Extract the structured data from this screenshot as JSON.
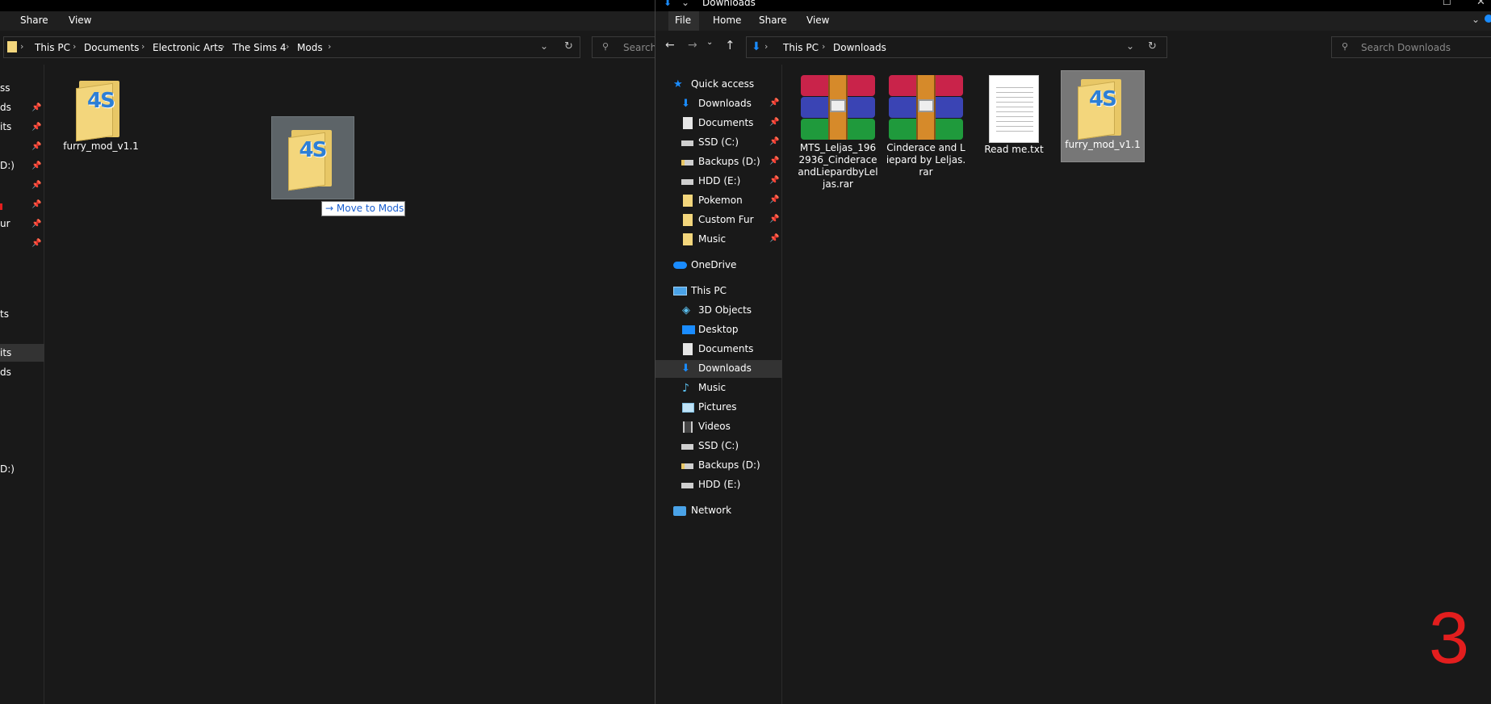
{
  "left_window": {
    "ribbon_tabs": [
      "Share",
      "View"
    ],
    "breadcrumb": [
      "This PC",
      "Documents",
      "Electronic Arts",
      "The Sims 4",
      "Mods"
    ],
    "search_placeholder": "Search",
    "sidebar_fragments": [
      {
        "text": "ss",
        "pinned": false
      },
      {
        "text": "ds",
        "pinned": true
      },
      {
        "text": "its",
        "pinned": true
      },
      {
        "text": "",
        "pinned": true
      },
      {
        "text": "D:)",
        "pinned": true
      },
      {
        "text": "",
        "pinned": true
      },
      {
        "text": "",
        "pinned": true
      },
      {
        "text": "ur",
        "pinned": true
      },
      {
        "text": "",
        "pinned": true
      },
      {
        "text": "ts",
        "pinned": false
      },
      {
        "text": "its",
        "pinned": false
      },
      {
        "text": "ds",
        "pinned": false
      },
      {
        "text": "D:)",
        "pinned": false
      }
    ],
    "files": [
      {
        "name": "furry_mod_v1.1",
        "icon": "sims4-folder-icon"
      }
    ],
    "drag_tooltip": "→ Move to Mods"
  },
  "right_window": {
    "title": "Downloads",
    "ribbon_tabs": [
      "File",
      "Home",
      "Share",
      "View"
    ],
    "breadcrumb": [
      "This PC",
      "Downloads"
    ],
    "search_placeholder": "Search Downloads",
    "nav_pane": {
      "quick_access": {
        "label": "Quick access",
        "items": [
          {
            "label": "Downloads",
            "icon": "download-arrow-icon",
            "pinned": true
          },
          {
            "label": "Documents",
            "icon": "document-icon",
            "pinned": true
          },
          {
            "label": "SSD (C:)",
            "icon": "drive-icon",
            "pinned": true
          },
          {
            "label": "Backups (D:)",
            "icon": "drive-lock-icon",
            "pinned": true
          },
          {
            "label": "HDD (E:)",
            "icon": "drive-icon",
            "pinned": true
          },
          {
            "label": "Pokemon",
            "icon": "folder-icon",
            "pinned": true
          },
          {
            "label": "Custom Fur",
            "icon": "folder-icon",
            "pinned": true
          },
          {
            "label": "Music",
            "icon": "folder-icon",
            "pinned": true
          }
        ]
      },
      "onedrive": "OneDrive",
      "this_pc": {
        "label": "This PC",
        "items": [
          {
            "label": "3D Objects",
            "icon": "cube-icon"
          },
          {
            "label": "Desktop",
            "icon": "desktop-icon"
          },
          {
            "label": "Documents",
            "icon": "document-icon"
          },
          {
            "label": "Downloads",
            "icon": "download-arrow-icon",
            "selected": true
          },
          {
            "label": "Music",
            "icon": "music-note-icon"
          },
          {
            "label": "Pictures",
            "icon": "pictures-icon"
          },
          {
            "label": "Videos",
            "icon": "video-icon"
          },
          {
            "label": "SSD (C:)",
            "icon": "drive-icon"
          },
          {
            "label": "Backups (D:)",
            "icon": "drive-lock-icon"
          },
          {
            "label": "HDD (E:)",
            "icon": "drive-icon"
          }
        ]
      },
      "network": "Network"
    },
    "files": [
      {
        "name": "MTS_Leljas_1962936_CinderaceandLiepardbyLeljas.rar",
        "icon": "winrar-icon",
        "selected": false
      },
      {
        "name": "Cinderace and Liepard by Leljas.rar",
        "icon": "winrar-icon",
        "selected": false
      },
      {
        "name": "Read me.txt",
        "icon": "text-file-icon",
        "selected": false
      },
      {
        "name": "furry_mod_v1.1",
        "icon": "sims4-folder-icon",
        "selected": true
      }
    ]
  },
  "overlay": {
    "step_number": "3",
    "step_color": "#e31e1e"
  },
  "colors": {
    "background": "#191919",
    "selection": "#333333",
    "accent_blue": "#1a8cff"
  }
}
